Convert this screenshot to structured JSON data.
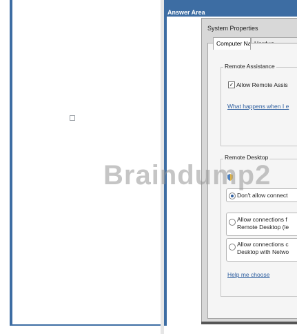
{
  "answer_area": {
    "header": "Answer Area"
  },
  "dialog": {
    "title": "System Properties",
    "tabs": [
      {
        "label": "Computer Name"
      },
      {
        "label": "Hardwa"
      }
    ],
    "remote_assistance": {
      "label": "Remote Assistance",
      "checkbox_label": "Allow Remote Assis",
      "checked": true,
      "link": "What happens when I e"
    },
    "remote_desktop": {
      "label": "Remote Desktop",
      "options": [
        {
          "line1": "Don't allow connect",
          "line2": "",
          "selected": true
        },
        {
          "line1": "Allow connections f",
          "line2": "Remote Desktop (le",
          "selected": false
        },
        {
          "line1": "Allow connections c",
          "line2": "Desktop with Netwo",
          "selected": false
        }
      ],
      "help_link": "Help me choose"
    }
  },
  "watermark": "Braindump2",
  "colors": {
    "frame_blue": "#3d6da3",
    "link_blue": "#2d5e9f",
    "dialog_gray": "#d8d8d8"
  }
}
